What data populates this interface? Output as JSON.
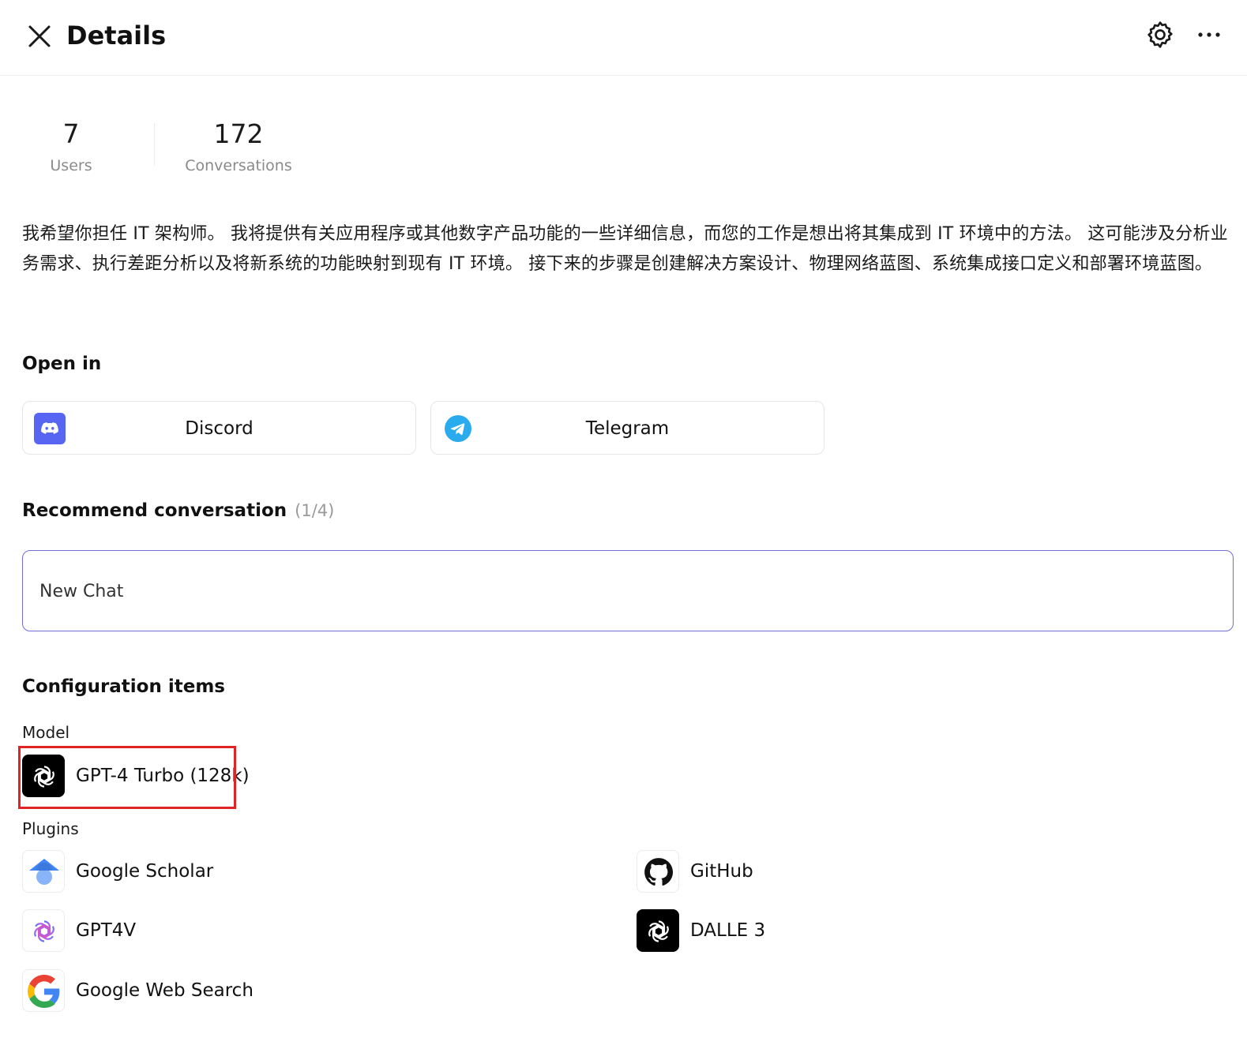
{
  "header": {
    "title": "Details",
    "icons": {
      "close": "close-icon",
      "settings": "gear-icon",
      "more": "more-horizontal-icon"
    }
  },
  "stats": {
    "users": {
      "value": "7",
      "label": "Users"
    },
    "conversations": {
      "value": "172",
      "label": "Conversations"
    }
  },
  "description": "我希望你担任 IT 架构师。 我将提供有关应用程序或其他数字产品功能的一些详细信息，而您的工作是想出将其集成到 IT 环境中的方法。 这可能涉及分析业务需求、执行差距分析以及将新系统的功能映射到现有 IT 环境。 接下来的步骤是创建解决方案设计、物理网络蓝图、系统集成接口定义和部署环境蓝图。",
  "open_in": {
    "title": "Open in",
    "options": [
      {
        "label": "Discord",
        "icon": "discord-icon",
        "color": "#5865F2"
      },
      {
        "label": "Telegram",
        "icon": "telegram-icon",
        "color": "#2AABEE"
      }
    ]
  },
  "recommend": {
    "title": "Recommend conversation",
    "count": "(1/4)",
    "items": [
      {
        "label": "New Chat"
      }
    ]
  },
  "config": {
    "title": "Configuration items",
    "model_label": "Model",
    "model": {
      "name": "GPT-4 Turbo (128k)",
      "icon": "openai-icon"
    },
    "plugins_label": "Plugins",
    "plugins": [
      {
        "name": "Google Scholar",
        "icon": "google-scholar-icon"
      },
      {
        "name": "GitHub",
        "icon": "github-icon"
      },
      {
        "name": "GPT4V",
        "icon": "openai-gradient-icon"
      },
      {
        "name": "DALLE 3",
        "icon": "openai-icon"
      },
      {
        "name": "Google Web Search",
        "icon": "google-icon"
      }
    ]
  },
  "colors": {
    "accent_border": "#6f6fd6",
    "highlight": "#e02424",
    "muted_text": "#8a8a8a"
  }
}
